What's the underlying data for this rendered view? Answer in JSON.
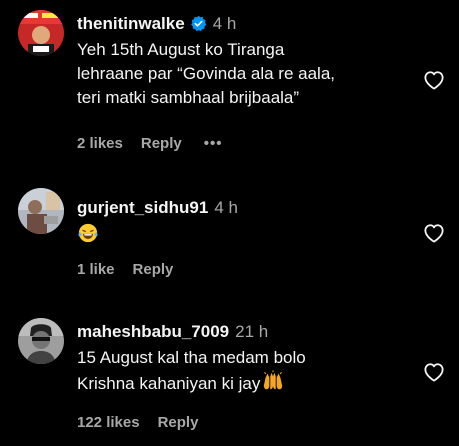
{
  "comments": [
    {
      "username": "thenitinwalke",
      "verified": true,
      "time": "4 h",
      "text_lines": [
        "Yeh 15th August ko Tiranga",
        "lehraane par “Govinda ala re aala,",
        "teri matki sambhaal brijbaala”"
      ],
      "likes": "2 likes",
      "reply_label": "Reply",
      "more_label": "•••"
    },
    {
      "username": "gurjent_sidhu91",
      "time": "4 h",
      "emoji": "face-with-tears-of-joy",
      "likes": "1 like",
      "reply_label": "Reply"
    },
    {
      "username": "maheshbabu_7009",
      "time": "21 h",
      "text_lines": [
        "15 August kal tha medam bolo",
        "Krishna kahaniyan ki jay"
      ],
      "emoji": "raising-hands",
      "likes": "122 likes",
      "reply_label": "Reply"
    }
  ],
  "colors": {
    "background": "#000000",
    "primary_text": "#f5f5f5",
    "secondary_text": "#a8a8a8",
    "verified_badge": "#0095f6"
  }
}
